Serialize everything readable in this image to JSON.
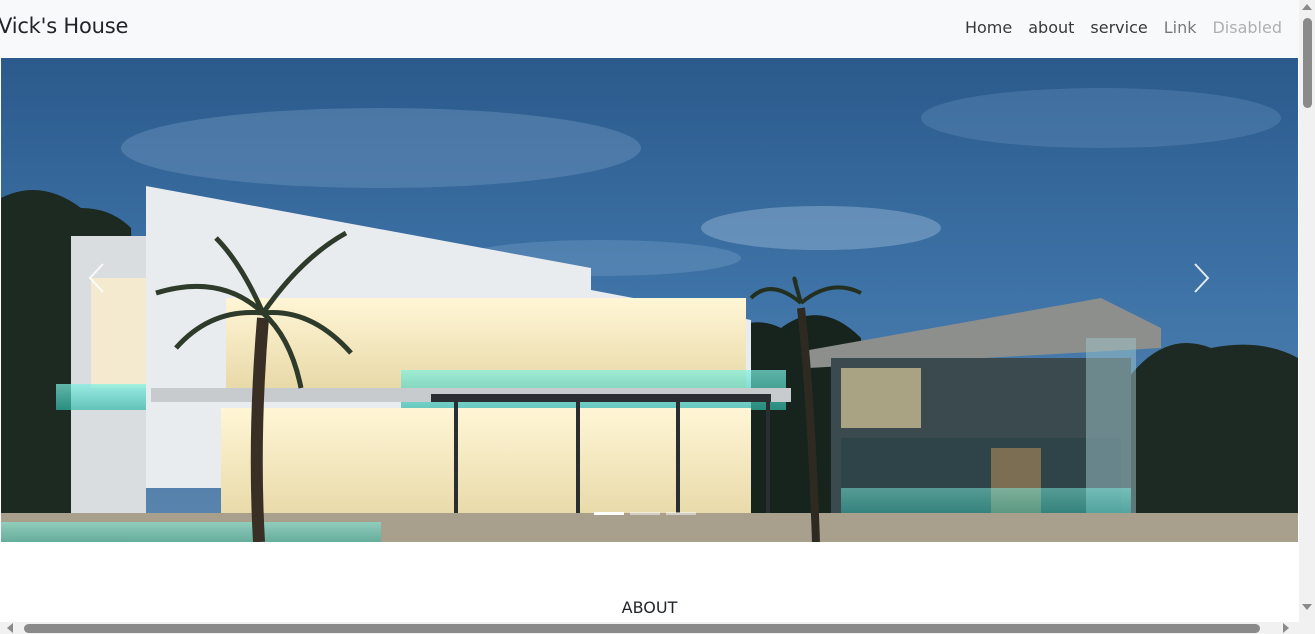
{
  "navbar": {
    "brand": "Vick's House",
    "links": [
      {
        "label": "Home",
        "state": "active"
      },
      {
        "label": "about",
        "state": "active"
      },
      {
        "label": "service",
        "state": "active"
      },
      {
        "label": "Link",
        "state": "normal"
      },
      {
        "label": "Disabled",
        "state": "disabled"
      }
    ]
  },
  "carousel": {
    "prev_icon": "chevron-left-icon",
    "next_icon": "chevron-right-icon",
    "slide_count": 3,
    "active_index": 0
  },
  "section": {
    "heading": "ABOUT"
  },
  "colors": {
    "navbar_bg": "#f8f9fa",
    "sky_top": "#2f5f92",
    "sky_bottom": "#4d7fae",
    "pool_glow": "#4fe0d0"
  }
}
